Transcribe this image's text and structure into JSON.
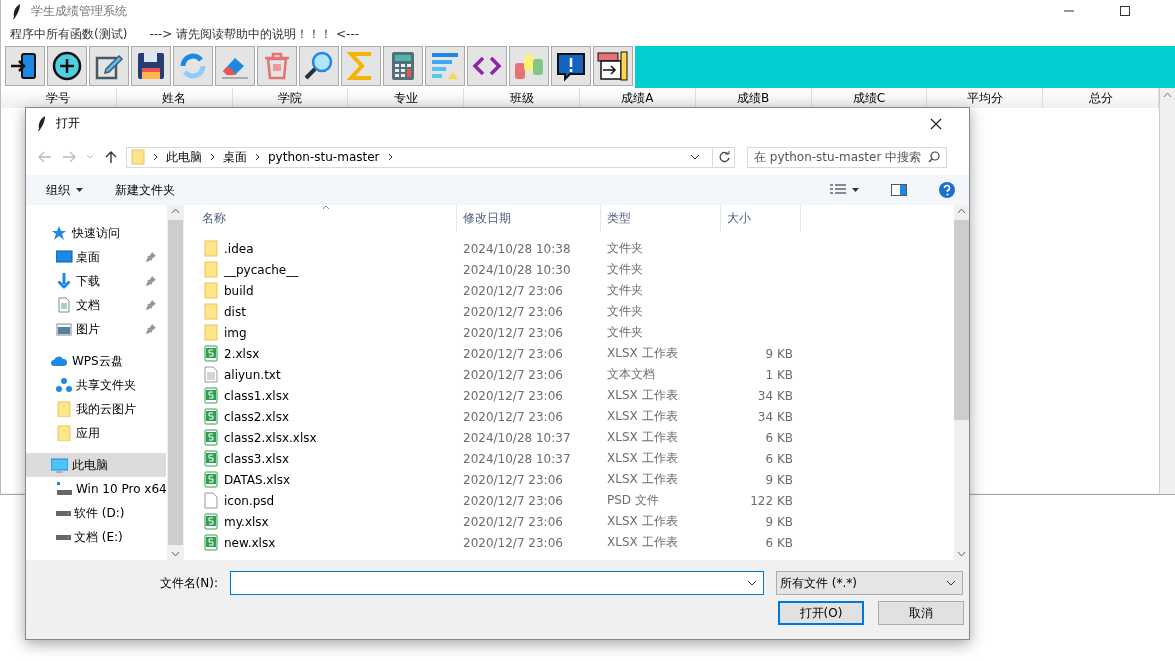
{
  "main_window": {
    "title": "学生成绩管理系统",
    "menu": [
      "程序中所有函数(测试)",
      "---> 请先阅读帮助中的说明！！！ <---"
    ],
    "table": {
      "columns": [
        "学号",
        "姓名",
        "学院",
        "专业",
        "班级",
        "成绩A",
        "成绩B",
        "成绩C",
        "平均分",
        "总分"
      ]
    }
  },
  "dialog": {
    "title": "打开",
    "breadcrumb": [
      "此电脑",
      "桌面",
      "python-stu-master"
    ],
    "search": {
      "placeholder": "在 python-stu-master 中搜索"
    },
    "commands": [
      {
        "label": "组织",
        "kind": "menu"
      },
      {
        "label": "新建文件夹",
        "kind": "plain"
      }
    ],
    "sidebar": [
      {
        "label": "快速访问",
        "kind": "star",
        "selected": false,
        "children": [
          {
            "label": "桌面",
            "kind": "desktop",
            "selected": false,
            "pinned": true
          },
          {
            "label": "下载",
            "kind": "download",
            "selected": false,
            "pinned": true
          },
          {
            "label": "文档",
            "kind": "document",
            "selected": false,
            "pinned": true
          },
          {
            "label": "图片",
            "kind": "pictures",
            "selected": false,
            "pinned": true
          }
        ]
      },
      {
        "label": "WPS云盘",
        "kind": "cloud",
        "selected": false,
        "children": [
          {
            "label": "共享文件夹",
            "kind": "share",
            "selected": false,
            "pinned": false
          },
          {
            "label": "我的云图片",
            "kind": "folder",
            "selected": false,
            "pinned": false
          },
          {
            "label": "应用",
            "kind": "folder",
            "selected": false,
            "pinned": false
          }
        ]
      },
      {
        "label": "此电脑",
        "kind": "computer",
        "selected": true,
        "children": [
          {
            "label": "Win 10 Pro x64",
            "kind": "system-drive",
            "selected": false,
            "pinned": false
          },
          {
            "label": "软件 (D:)",
            "kind": "drive",
            "selected": false,
            "pinned": false
          },
          {
            "label": "文档 (E:)",
            "kind": "drive",
            "selected": false,
            "pinned": false
          }
        ]
      }
    ],
    "columns": [
      "名称",
      "修改日期",
      "类型",
      "大小"
    ],
    "files": [
      {
        "name": ".idea",
        "date": "2024/10/28 10:38",
        "type": "文件夹",
        "kind": "folder"
      },
      {
        "name": "__pycache__",
        "date": "2024/10/28 10:30",
        "type": "文件夹",
        "kind": "folder"
      },
      {
        "name": "build",
        "date": "2020/12/7 23:06",
        "type": "文件夹",
        "kind": "folder"
      },
      {
        "name": "dist",
        "date": "2020/12/7 23:06",
        "type": "文件夹",
        "kind": "folder"
      },
      {
        "name": "img",
        "date": "2020/12/7 23:06",
        "type": "文件夹",
        "kind": "folder"
      },
      {
        "name": "2.xlsx",
        "date": "2020/12/7 23:06",
        "type": "XLSX 工作表",
        "size": "9 KB",
        "kind": "sheet"
      },
      {
        "name": "aliyun.txt",
        "date": "2020/12/7 23:06",
        "type": "文本文档",
        "size": "1 KB",
        "kind": "text"
      },
      {
        "name": "class1.xlsx",
        "date": "2020/12/7 23:06",
        "type": "XLSX 工作表",
        "size": "34 KB",
        "kind": "sheet"
      },
      {
        "name": "class2.xlsx",
        "date": "2020/12/7 23:06",
        "type": "XLSX 工作表",
        "size": "34 KB",
        "kind": "sheet"
      },
      {
        "name": "class2.xlsx.xlsx",
        "date": "2024/10/28 10:37",
        "type": "XLSX 工作表",
        "size": "6 KB",
        "kind": "sheet"
      },
      {
        "name": "class3.xlsx",
        "date": "2024/10/28 10:37",
        "type": "XLSX 工作表",
        "size": "6 KB",
        "kind": "sheet"
      },
      {
        "name": "DATAS.xlsx",
        "date": "2020/12/7 23:06",
        "type": "XLSX 工作表",
        "size": "9 KB",
        "kind": "sheet"
      },
      {
        "name": "icon.psd",
        "date": "2020/12/7 23:06",
        "type": "PSD 文件",
        "size": "122 KB",
        "kind": "blank"
      },
      {
        "name": "my.xlsx",
        "date": "2020/12/7 23:06",
        "type": "XLSX 工作表",
        "size": "9 KB",
        "kind": "sheet"
      },
      {
        "name": "new.xlsx",
        "date": "2020/12/7 23:06",
        "type": "XLSX 工作表",
        "size": "6 KB",
        "kind": "sheet"
      }
    ],
    "filename": {
      "label": "文件名(N):"
    },
    "filter": "所有文件 (*.*)",
    "buttons": [
      {
        "label": "打开(O)",
        "kind": "primary"
      },
      {
        "label": "取消",
        "kind": "normal"
      }
    ]
  }
}
